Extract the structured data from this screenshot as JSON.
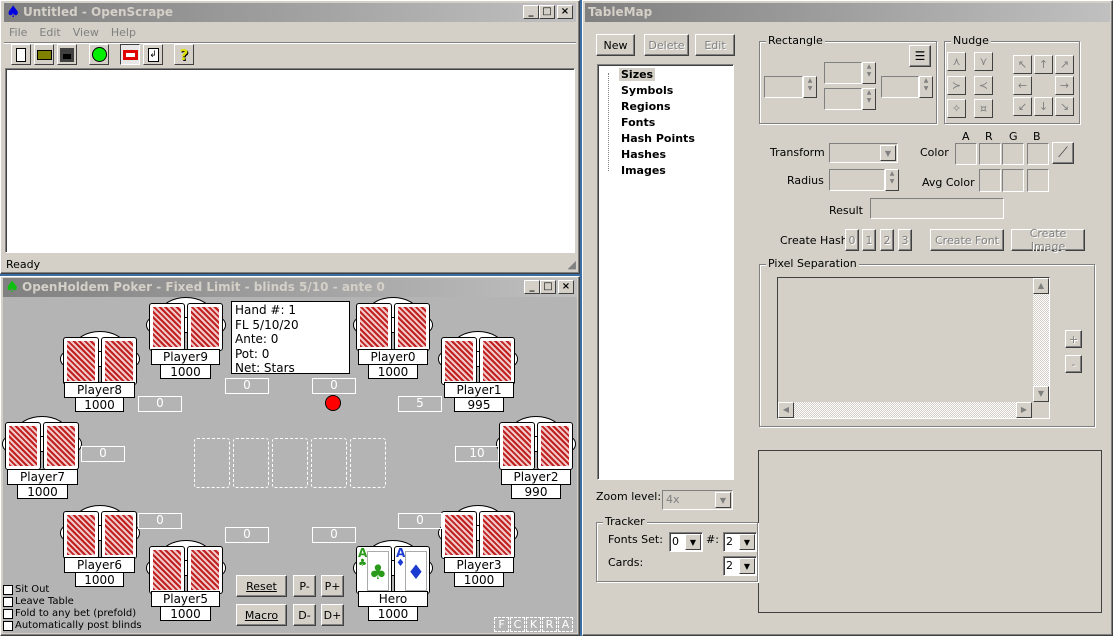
{
  "openscrape": {
    "title": "Untitled - OpenScrape",
    "menu": [
      "File",
      "Edit",
      "View",
      "Help"
    ],
    "status": "Ready",
    "toolbar": [
      "new-file-icon",
      "open-folder-icon",
      "save-disk-icon",
      "green-circle-icon",
      "red-rectangle-icon",
      "refresh-document-icon",
      "help-question-icon"
    ]
  },
  "holdem": {
    "title": "OpenHoldem Poker - Fixed Limit - blinds 5/10 - ante 0",
    "info": [
      "Hand #: 1",
      "FL 5/10/20",
      "Ante: 0",
      "Pot: 0",
      "Net: Stars"
    ],
    "players": [
      {
        "name": "Player9",
        "balance": "1000",
        "bet": "0"
      },
      {
        "name": "Player0",
        "balance": "1000",
        "bet": "0"
      },
      {
        "name": "Player8",
        "balance": "1000",
        "bet": "0"
      },
      {
        "name": "Player1",
        "balance": "995",
        "bet": "5"
      },
      {
        "name": "Player7",
        "balance": "1000",
        "bet": "0"
      },
      {
        "name": "Player2",
        "balance": "990",
        "bet": "10"
      },
      {
        "name": "Player6",
        "balance": "1000",
        "bet": "0"
      },
      {
        "name": "Player3",
        "balance": "1000",
        "bet": "0"
      },
      {
        "name": "Player5",
        "balance": "1000",
        "bet": "0"
      },
      {
        "name": "Hero",
        "balance": "1000",
        "bet": "0"
      }
    ],
    "hero_cards": [
      {
        "rank": "A",
        "suit": "♣",
        "color": "#2a9a1a"
      },
      {
        "rank": "A",
        "suit": "♦",
        "color": "#1a3ad0"
      }
    ],
    "dealer_color": "#ff0000",
    "buttons": {
      "reset": "Reset",
      "macro": "Macro",
      "p_minus": "P-",
      "p_plus": "P+",
      "d_minus": "D-",
      "d_plus": "D+"
    },
    "checkboxes": [
      "Sit Out",
      "Leave Table",
      "Fold to any bet (prefold)",
      "Automatically post blinds"
    ],
    "actions": [
      "F",
      "C",
      "K",
      "R",
      "A"
    ]
  },
  "tablemap": {
    "title": "TableMap",
    "new": "New",
    "delete": "Delete",
    "edit": "Edit",
    "tree": [
      "Sizes",
      "Symbols",
      "Regions",
      "Fonts",
      "Hash Points",
      "Hashes",
      "Images"
    ],
    "selected": "Sizes",
    "rectangle": "Rectangle",
    "nudge": "Nudge",
    "argb": [
      "A",
      "R",
      "G",
      "B"
    ],
    "transform": "Transform",
    "color": "Color",
    "radius": "Radius",
    "avg_color": "Avg Color",
    "result": "Result",
    "create_hash": "Create Hash",
    "hash_buttons": [
      "0",
      "1",
      "2",
      "3"
    ],
    "create_font": "Create Font",
    "create_image": "Create Image",
    "pixel_separation": "Pixel Separation",
    "plus": "+",
    "minus": "-",
    "zoom_label": "Zoom level:",
    "zoom_value": "4x",
    "tracker": "Tracker",
    "fonts_set": "Fonts Set:",
    "fonts_set_value": "0",
    "hash_label": "#:",
    "hash_value": "2",
    "cards": "Cards:",
    "cards_value": "2"
  }
}
